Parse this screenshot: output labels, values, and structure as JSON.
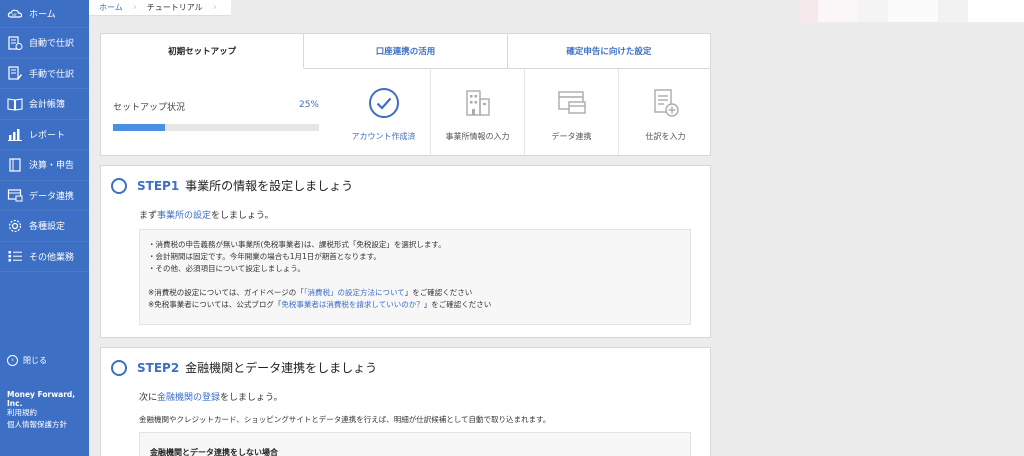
{
  "sidebar": {
    "items": [
      {
        "label": "ホーム",
        "icon": "mf-cloud-logo-icon"
      },
      {
        "label": "自動で仕訳",
        "icon": "auto-journal-icon"
      },
      {
        "label": "手動で仕訳",
        "icon": "manual-journal-icon"
      },
      {
        "label": "会計帳簿",
        "icon": "ledger-book-icon"
      },
      {
        "label": "レポート",
        "icon": "bar-chart-icon"
      },
      {
        "label": "決算・申告",
        "icon": "document-icon"
      },
      {
        "label": "データ連携",
        "icon": "data-link-icon"
      },
      {
        "label": "各種設定",
        "icon": "gear-icon"
      },
      {
        "label": "その他業務",
        "icon": "list-icon"
      }
    ],
    "close_label": "閉じる",
    "company": "Money Forward, Inc.",
    "links": [
      "利用規約",
      "個人情報保護方針"
    ]
  },
  "breadcrumb": {
    "home": "ホーム",
    "current": "チュートリアル"
  },
  "tabs": [
    "初期セットアップ",
    "口座連携の活用",
    "確定申告に向けた設定"
  ],
  "setup": {
    "label": "セットアップ状況",
    "percent_text": "25%",
    "progress": 0.25
  },
  "steps": [
    {
      "label": "アカウント作成済",
      "icon": "check-circle-icon",
      "done": true
    },
    {
      "label": "事業所情報の入力",
      "icon": "building-icon",
      "done": false
    },
    {
      "label": "データ連携",
      "icon": "card-link-icon",
      "done": false
    },
    {
      "label": "仕訳を入力",
      "icon": "journal-add-icon",
      "done": false
    }
  ],
  "step1": {
    "tag": "STEP1",
    "title": "事業所の情報を設定しましょう",
    "sub_prefix": "まず",
    "sub_link": "事業所の設定",
    "sub_suffix": "をしましょう。",
    "notes": [
      "・消費税の申告義務が無い事業所(免税事業者)は、課税形式「免税設定」を選択します。",
      "・会計期間は固定です。今年開業の場合も1月1日が期首となります。",
      "・その他、必須項目について設定しましょう。"
    ],
    "ref1_prefix": "※消費税の設定については、ガイドページの「",
    "ref1_link": "「消費税」の設定方法について",
    "ref1_suffix": "」をご確認ください",
    "ref2_prefix": "※免税事業者については、公式ブログ「",
    "ref2_link": "免税事業者は消費税を請求していいのか？",
    "ref2_suffix": "」をご確認ください"
  },
  "step2": {
    "tag": "STEP2",
    "title": "金融機関とデータ連携をしましょう",
    "sub_prefix": "次に",
    "sub_link": "金融機関の登録",
    "sub_suffix": "をしましょう。",
    "para": "金融機関やクレジットカード、ショッピングサイトとデータ連携を行えば、明細が仕訳候補として自動で取り込まれます。",
    "box_title": "金融機関とデータ連携をしない場合"
  },
  "colors": {
    "sidebar": "#3d6fc4",
    "accent": "#3d6fc4",
    "progress": "#4a90e2"
  }
}
